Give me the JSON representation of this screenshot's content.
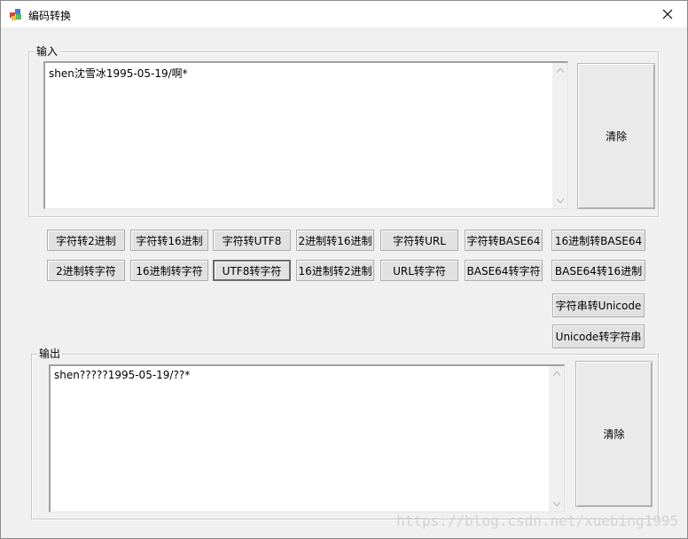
{
  "window": {
    "title": "编码转换",
    "app_icon": "app-cube-icon",
    "close_icon": "close-icon"
  },
  "input_group": {
    "label": "输入",
    "text": "shen沈雪冰1995-05-19/啊*",
    "clear_label": "清除"
  },
  "output_group": {
    "label": "输出",
    "text": "shen?????1995-05-19/??*",
    "clear_label": "清除"
  },
  "buttons_row1": [
    "字符转2进制",
    "字符转16进制",
    "字符转UTF8",
    "2进制转16进制",
    "字符转URL",
    "字符转BASE64",
    "16进制转BASE64"
  ],
  "buttons_row2": [
    "2进制转字符",
    "16进制转字符",
    "UTF8转字符",
    "16进制转2进制",
    "URL转字符",
    "BASE64转字符",
    "BASE64转16进制"
  ],
  "unicode_buttons": {
    "to_unicode": "字符串转Unicode",
    "from_unicode": "Unicode转字符串"
  },
  "watermark": "https://blog.csdn.net/xuebing1995",
  "colors": {
    "title_bg": "#ffffff",
    "window_bg": "#f0f0f0",
    "button_bg": "#e1e1e1",
    "button_border": "#adadad",
    "focused_border": "#6a6a6a",
    "watermark": "#d2d2d2"
  }
}
